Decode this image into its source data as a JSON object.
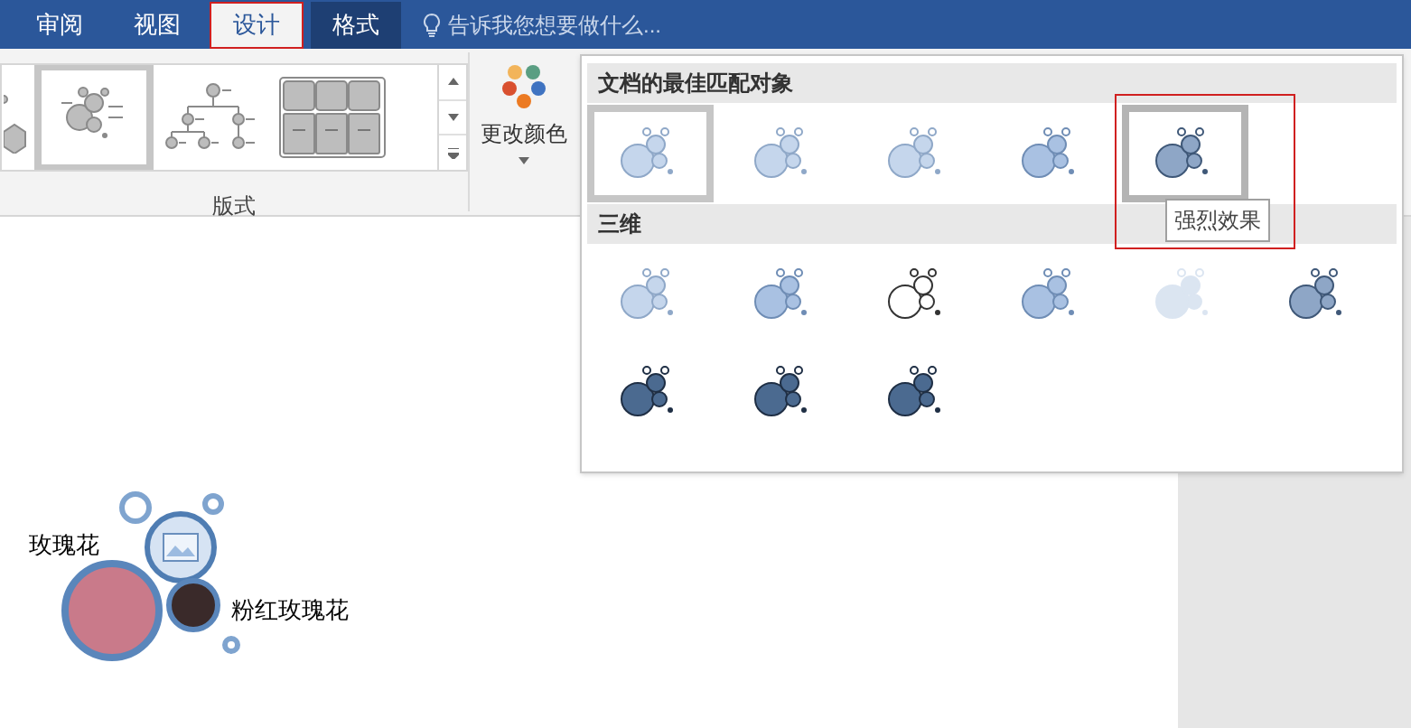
{
  "tabs": [
    {
      "label": "审阅",
      "selected": false,
      "kind": "normal"
    },
    {
      "label": "视图",
      "selected": false,
      "kind": "normal"
    },
    {
      "label": "设计",
      "selected": true,
      "kind": "normal"
    },
    {
      "label": "格式",
      "selected": false,
      "kind": "contextual"
    }
  ],
  "tell_me": {
    "placeholder": "告诉我您想要做什么..."
  },
  "layouts": {
    "label": "版式",
    "items": [
      {
        "kind": "hexagon",
        "selected": false
      },
      {
        "kind": "bubble",
        "selected": true
      },
      {
        "kind": "hierarchy",
        "selected": false
      },
      {
        "kind": "table",
        "selected": false
      }
    ]
  },
  "change_colors": {
    "label": "更改颜色"
  },
  "styles_gallery": {
    "sections": [
      {
        "title": "文档的最佳匹配对象",
        "items": [
          {
            "kind": "pale",
            "selected": true,
            "hovered": false
          },
          {
            "kind": "pale",
            "selected": false,
            "hovered": false
          },
          {
            "kind": "pale",
            "selected": false,
            "hovered": false
          },
          {
            "kind": "medium",
            "selected": false,
            "hovered": false
          },
          {
            "kind": "strong",
            "selected": false,
            "hovered": true
          }
        ]
      },
      {
        "title": "三维",
        "items": [
          {
            "kind": "pale",
            "selected": false,
            "hovered": false
          },
          {
            "kind": "medium",
            "selected": false,
            "hovered": false
          },
          {
            "kind": "outline",
            "selected": false,
            "hovered": false
          },
          {
            "kind": "medium",
            "selected": false,
            "hovered": false
          },
          {
            "kind": "faint",
            "selected": false,
            "hovered": false
          },
          {
            "kind": "strong",
            "selected": false,
            "hovered": false
          },
          {
            "kind": "dark",
            "selected": false,
            "hovered": false
          },
          {
            "kind": "dark",
            "selected": false,
            "hovered": false
          },
          {
            "kind": "dark",
            "selected": false,
            "hovered": false
          }
        ]
      }
    ],
    "tooltip": "强烈效果"
  },
  "smartart": {
    "labels": [
      "玫瑰花",
      "粉红玫瑰花"
    ]
  }
}
